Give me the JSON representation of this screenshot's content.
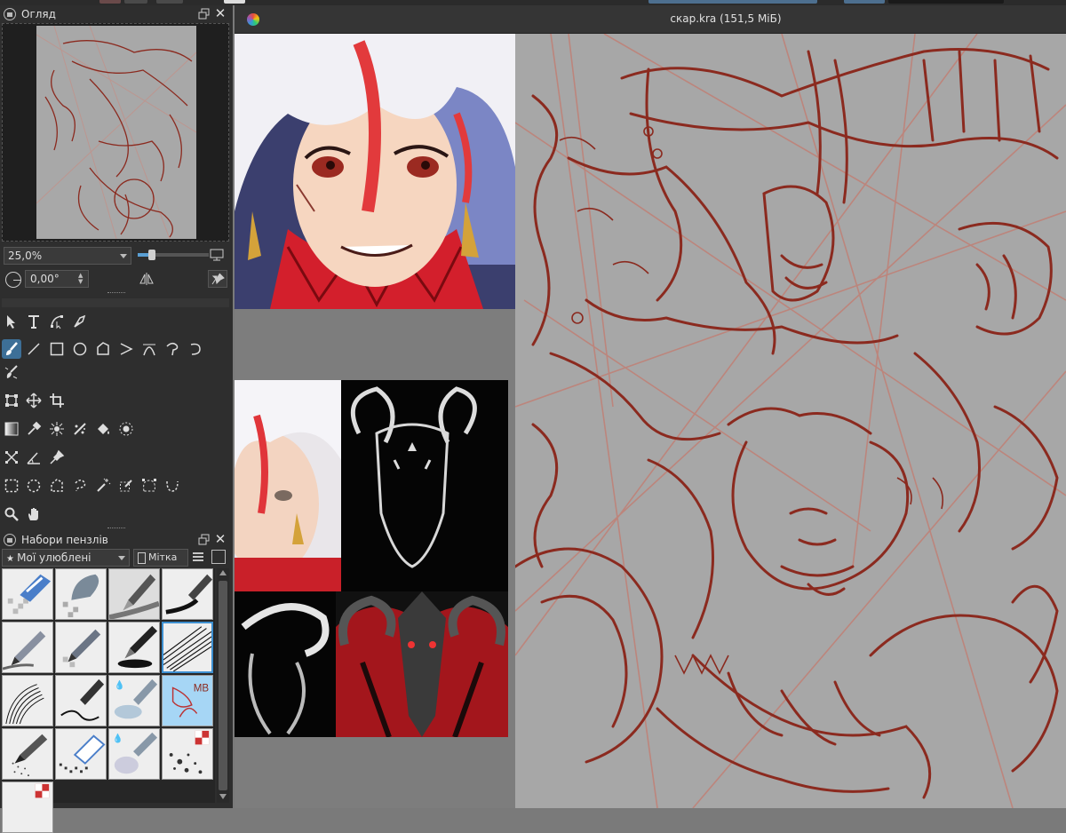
{
  "overview_panel": {
    "title": "Огляд",
    "zoom": "25,0%",
    "rotation": "0,00°"
  },
  "brush_panel": {
    "title": "Набори пензлів",
    "tag": "Мої улюблені",
    "tag_button": "Мітка",
    "selected_preset_index": 7,
    "presets": [
      {
        "icon": "eraser-icon"
      },
      {
        "icon": "blender-icon"
      },
      {
        "icon": "ink-pen-icon"
      },
      {
        "icon": "marker-icon"
      },
      {
        "icon": "pencil-icon"
      },
      {
        "icon": "pencil-soft-icon"
      },
      {
        "icon": "fountain-pen-icon"
      },
      {
        "icon": "bristles-icon"
      },
      {
        "icon": "hatching-icon"
      },
      {
        "icon": "fineliner-icon"
      },
      {
        "icon": "watercolor-icon"
      },
      {
        "icon": "sketch-brush-icon"
      },
      {
        "icon": "airbrush-icon"
      },
      {
        "icon": "eraser-soft-icon"
      },
      {
        "icon": "wet-brush-icon"
      },
      {
        "icon": "splatter-icon"
      },
      {
        "icon": "texture-icon"
      }
    ]
  },
  "document": {
    "title": "скар.kra (151,5 МіБ)"
  },
  "colors": {
    "accent": "#3d6f97",
    "panel": "#2e2e2e",
    "sketch": "#8b2a1f",
    "canvas_bg": "#a7a7a7"
  }
}
